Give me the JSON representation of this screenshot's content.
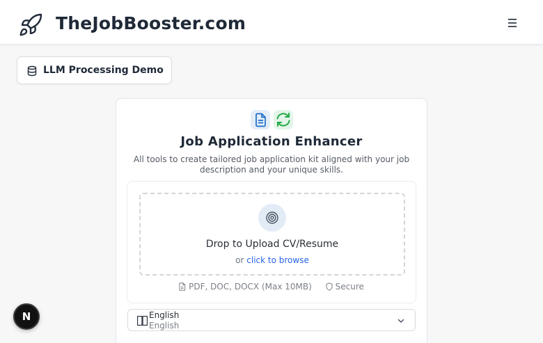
{
  "header": {
    "brand": "TheJobBooster.com",
    "logo_icon": "rocket-icon",
    "menu_icon": "hamburger-menu-icon"
  },
  "demo_button": {
    "label": "LLM Processing Demo",
    "icon": "database-icon"
  },
  "card": {
    "title": "Job Application Enhancer",
    "subtitle": "All tools to create tailored job application kit aligned with your job description and your unique skills.",
    "icons": [
      "document-icon",
      "refresh-icon"
    ],
    "upload": {
      "icon": "target-icon",
      "title": "Drop to Upload CV/Resume",
      "or_text": "or",
      "browse_link": "click to browse",
      "formats": "PDF, DOC, DOCX (Max 10MB)",
      "secure": "Secure"
    },
    "language": {
      "label": "English",
      "value": "English",
      "icon": "language-icon"
    }
  },
  "dev_badge": {
    "letter": "N"
  },
  "colors": {
    "background": "#f7f7f8",
    "link": "#2563eb",
    "doc_icon": "#1c6fc7",
    "refresh_icon": "#22a846",
    "upload_circle": "#e3ecf6"
  }
}
